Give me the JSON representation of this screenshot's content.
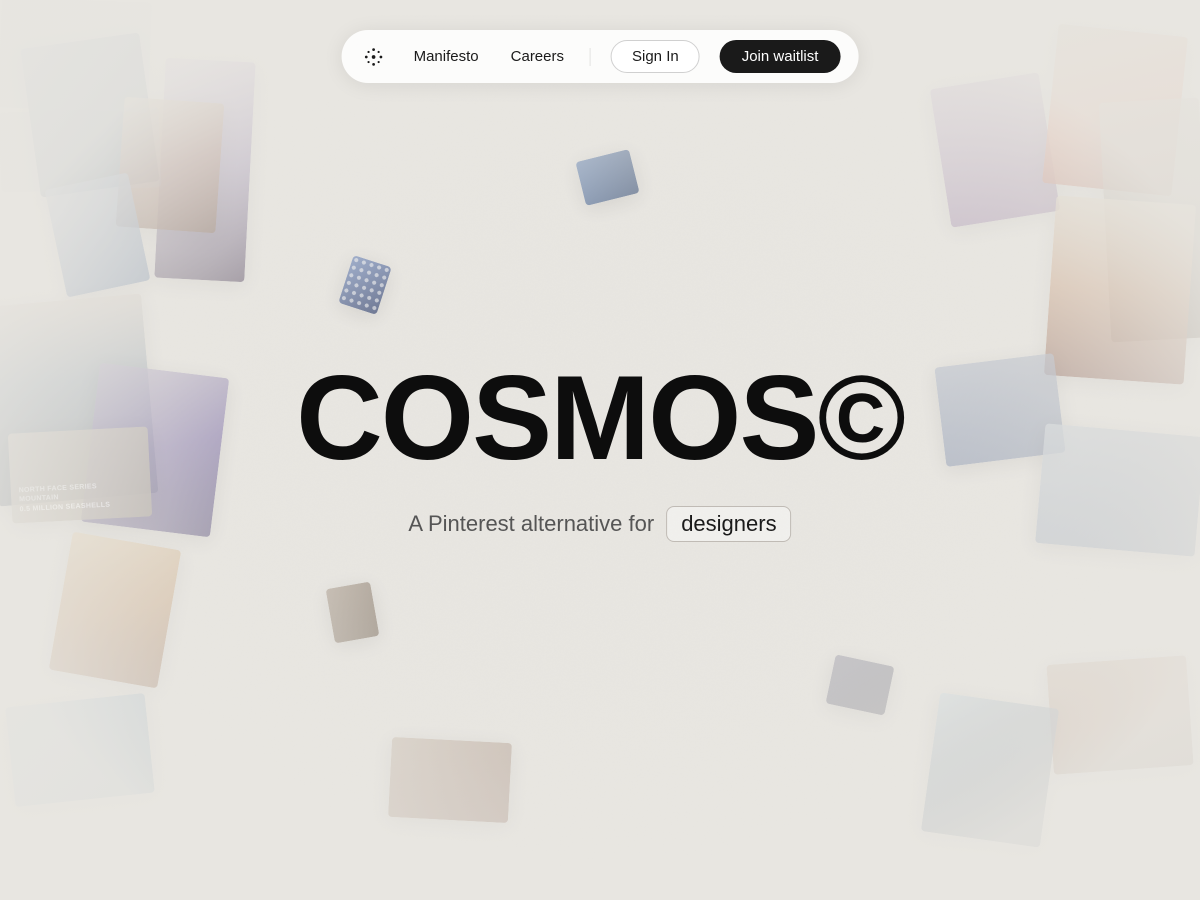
{
  "nav": {
    "logo_icon": "cosmos-logo-icon",
    "links": [
      {
        "label": "Manifesto",
        "id": "manifesto"
      },
      {
        "label": "Careers",
        "id": "careers"
      }
    ],
    "signin_label": "Sign In",
    "join_label": "Join waitlist"
  },
  "hero": {
    "title": "COSMOS©",
    "subtitle_text": "A Pinterest alternative for",
    "badge_text": "designers"
  },
  "images": {
    "cards": [
      {
        "id": "card-1",
        "alt": "abstract figure photo"
      },
      {
        "id": "card-2",
        "alt": "warm toned photo"
      },
      {
        "id": "card-3",
        "alt": "blue toned photo"
      },
      {
        "id": "card-4",
        "alt": "ocean landscape photo"
      },
      {
        "id": "card-5",
        "alt": "purple toned art photo"
      },
      {
        "id": "card-6",
        "alt": "text card",
        "text_lines": [
          "NORTH FACE SERIES",
          "MOUNTAIN",
          "0.5 MILLION SEASHELLS"
        ]
      },
      {
        "id": "card-7",
        "alt": "warm figure photo"
      },
      {
        "id": "card-8",
        "alt": "blue landscape"
      },
      {
        "id": "card-9",
        "alt": "earth tones photo"
      },
      {
        "id": "card-10",
        "alt": "small blue card"
      },
      {
        "id": "card-11",
        "alt": "small blue polka card"
      },
      {
        "id": "card-12",
        "alt": "warm orange photo"
      },
      {
        "id": "card-13",
        "alt": "purple toned photo"
      },
      {
        "id": "card-14",
        "alt": "warm portrait photo"
      },
      {
        "id": "card-15",
        "alt": "blue grey photo"
      },
      {
        "id": "card-16",
        "alt": "light blue grey photo"
      },
      {
        "id": "card-17",
        "alt": "earthy tones photo"
      },
      {
        "id": "card-18",
        "alt": "cool tones photo"
      },
      {
        "id": "card-19",
        "alt": "small earth tone card"
      },
      {
        "id": "card-20",
        "alt": "small grey card"
      }
    ]
  }
}
